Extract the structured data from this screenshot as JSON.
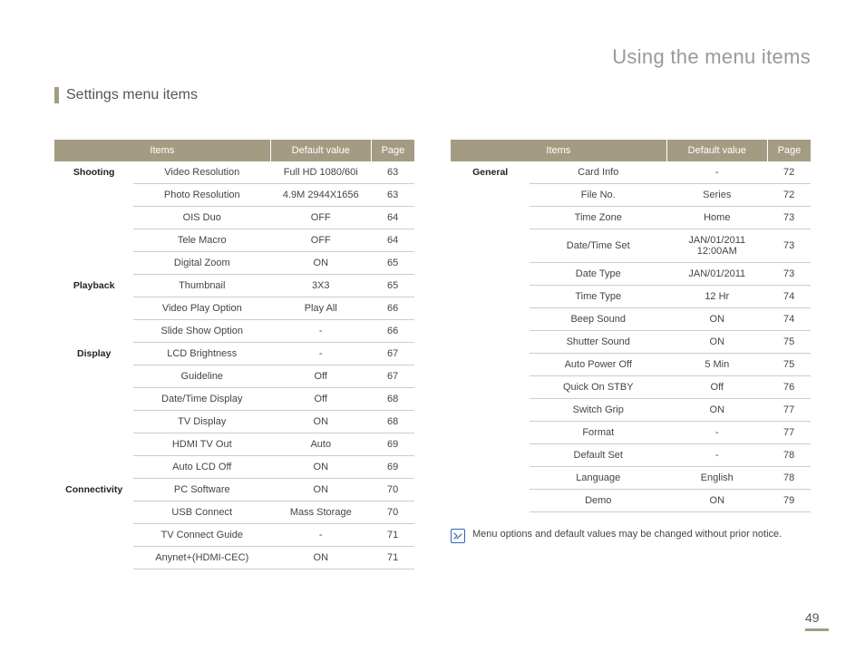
{
  "chapter_title": "Using the menu items",
  "section_title": "Settings menu items",
  "headers": {
    "items": "Items",
    "default": "Default value",
    "page": "Page"
  },
  "left": [
    {
      "category": "Shooting",
      "rows": [
        {
          "item": "Video Resolution",
          "default": "Full HD  1080/60i",
          "page": "63"
        },
        {
          "item": "Photo Resolution",
          "default": "4.9M  2944X1656",
          "page": "63"
        },
        {
          "item": "OIS Duo",
          "default": "OFF",
          "page": "64"
        },
        {
          "item": "Tele Macro",
          "default": "OFF",
          "page": "64"
        },
        {
          "item": "Digital Zoom",
          "default": "ON",
          "page": "65"
        }
      ]
    },
    {
      "category": "Playback",
      "rows": [
        {
          "item": "Thumbnail",
          "default": "3X3",
          "page": "65"
        },
        {
          "item": "Video Play Option",
          "default": "Play All",
          "page": "66"
        },
        {
          "item": "Slide Show Option",
          "default": "-",
          "page": "66"
        }
      ]
    },
    {
      "category": "Display",
      "rows": [
        {
          "item": "LCD Brightness",
          "default": "-",
          "page": "67"
        },
        {
          "item": "Guideline",
          "default": "Off",
          "page": "67"
        },
        {
          "item": "Date/Time Display",
          "default": "Off",
          "page": "68"
        },
        {
          "item": "TV Display",
          "default": "ON",
          "page": "68"
        },
        {
          "item": "HDMI TV Out",
          "default": "Auto",
          "page": "69"
        },
        {
          "item": "Auto LCD Off",
          "default": "ON",
          "page": "69"
        }
      ]
    },
    {
      "category": "Connectivity",
      "rows": [
        {
          "item": "PC Software",
          "default": "ON",
          "page": "70"
        },
        {
          "item": "USB Connect",
          "default": "Mass Storage",
          "page": "70"
        },
        {
          "item": "TV Connect Guide",
          "default": "-",
          "page": "71"
        },
        {
          "item": "Anynet+(HDMI-CEC)",
          "default": "ON",
          "page": "71"
        }
      ]
    }
  ],
  "right": [
    {
      "category": "General",
      "rows": [
        {
          "item": "Card Info",
          "default": "-",
          "page": "72"
        },
        {
          "item": "File No.",
          "default": "Series",
          "page": "72"
        },
        {
          "item": "Time Zone",
          "default": "Home",
          "page": "73"
        },
        {
          "item": "Date/Time Set",
          "default": "JAN/01/2011 12:00AM",
          "page": "73"
        },
        {
          "item": "Date Type",
          "default": "JAN/01/2011",
          "page": "73"
        },
        {
          "item": "Time Type",
          "default": "12 Hr",
          "page": "74"
        },
        {
          "item": "Beep Sound",
          "default": "ON",
          "page": "74"
        },
        {
          "item": "Shutter Sound",
          "default": "ON",
          "page": "75"
        },
        {
          "item": "Auto Power Off",
          "default": "5 Min",
          "page": "75"
        },
        {
          "item": "Quick On STBY",
          "default": "Off",
          "page": "76"
        },
        {
          "item": "Switch Grip",
          "default": "ON",
          "page": "77"
        },
        {
          "item": "Format",
          "default": "-",
          "page": "77"
        },
        {
          "item": "Default Set",
          "default": "-",
          "page": "78"
        },
        {
          "item": "Language",
          "default": "English",
          "page": "78"
        },
        {
          "item": "Demo",
          "default": "ON",
          "page": "79"
        }
      ]
    }
  ],
  "note_text": "Menu options and default values may be changed without prior notice.",
  "page_number": "49"
}
